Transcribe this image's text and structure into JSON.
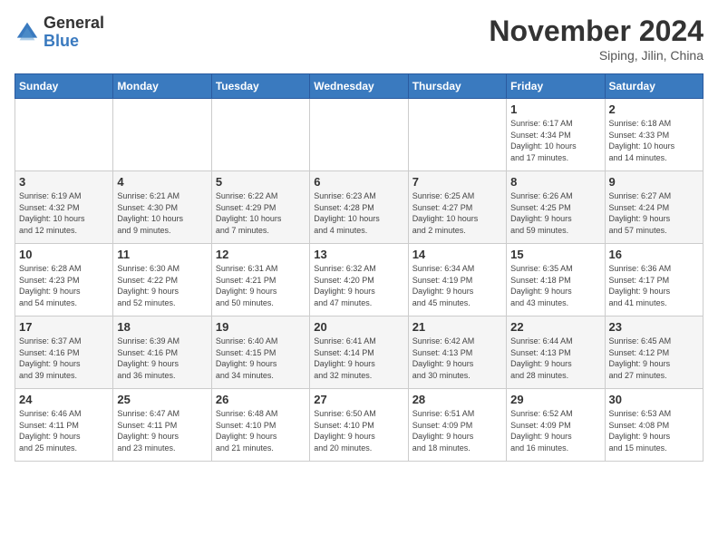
{
  "logo": {
    "general": "General",
    "blue": "Blue"
  },
  "title": "November 2024",
  "subtitle": "Siping, Jilin, China",
  "days_header": [
    "Sunday",
    "Monday",
    "Tuesday",
    "Wednesday",
    "Thursday",
    "Friday",
    "Saturday"
  ],
  "weeks": [
    [
      {
        "day": "",
        "info": ""
      },
      {
        "day": "",
        "info": ""
      },
      {
        "day": "",
        "info": ""
      },
      {
        "day": "",
        "info": ""
      },
      {
        "day": "",
        "info": ""
      },
      {
        "day": "1",
        "info": "Sunrise: 6:17 AM\nSunset: 4:34 PM\nDaylight: 10 hours\nand 17 minutes."
      },
      {
        "day": "2",
        "info": "Sunrise: 6:18 AM\nSunset: 4:33 PM\nDaylight: 10 hours\nand 14 minutes."
      }
    ],
    [
      {
        "day": "3",
        "info": "Sunrise: 6:19 AM\nSunset: 4:32 PM\nDaylight: 10 hours\nand 12 minutes."
      },
      {
        "day": "4",
        "info": "Sunrise: 6:21 AM\nSunset: 4:30 PM\nDaylight: 10 hours\nand 9 minutes."
      },
      {
        "day": "5",
        "info": "Sunrise: 6:22 AM\nSunset: 4:29 PM\nDaylight: 10 hours\nand 7 minutes."
      },
      {
        "day": "6",
        "info": "Sunrise: 6:23 AM\nSunset: 4:28 PM\nDaylight: 10 hours\nand 4 minutes."
      },
      {
        "day": "7",
        "info": "Sunrise: 6:25 AM\nSunset: 4:27 PM\nDaylight: 10 hours\nand 2 minutes."
      },
      {
        "day": "8",
        "info": "Sunrise: 6:26 AM\nSunset: 4:25 PM\nDaylight: 9 hours\nand 59 minutes."
      },
      {
        "day": "9",
        "info": "Sunrise: 6:27 AM\nSunset: 4:24 PM\nDaylight: 9 hours\nand 57 minutes."
      }
    ],
    [
      {
        "day": "10",
        "info": "Sunrise: 6:28 AM\nSunset: 4:23 PM\nDaylight: 9 hours\nand 54 minutes."
      },
      {
        "day": "11",
        "info": "Sunrise: 6:30 AM\nSunset: 4:22 PM\nDaylight: 9 hours\nand 52 minutes."
      },
      {
        "day": "12",
        "info": "Sunrise: 6:31 AM\nSunset: 4:21 PM\nDaylight: 9 hours\nand 50 minutes."
      },
      {
        "day": "13",
        "info": "Sunrise: 6:32 AM\nSunset: 4:20 PM\nDaylight: 9 hours\nand 47 minutes."
      },
      {
        "day": "14",
        "info": "Sunrise: 6:34 AM\nSunset: 4:19 PM\nDaylight: 9 hours\nand 45 minutes."
      },
      {
        "day": "15",
        "info": "Sunrise: 6:35 AM\nSunset: 4:18 PM\nDaylight: 9 hours\nand 43 minutes."
      },
      {
        "day": "16",
        "info": "Sunrise: 6:36 AM\nSunset: 4:17 PM\nDaylight: 9 hours\nand 41 minutes."
      }
    ],
    [
      {
        "day": "17",
        "info": "Sunrise: 6:37 AM\nSunset: 4:16 PM\nDaylight: 9 hours\nand 39 minutes."
      },
      {
        "day": "18",
        "info": "Sunrise: 6:39 AM\nSunset: 4:16 PM\nDaylight: 9 hours\nand 36 minutes."
      },
      {
        "day": "19",
        "info": "Sunrise: 6:40 AM\nSunset: 4:15 PM\nDaylight: 9 hours\nand 34 minutes."
      },
      {
        "day": "20",
        "info": "Sunrise: 6:41 AM\nSunset: 4:14 PM\nDaylight: 9 hours\nand 32 minutes."
      },
      {
        "day": "21",
        "info": "Sunrise: 6:42 AM\nSunset: 4:13 PM\nDaylight: 9 hours\nand 30 minutes."
      },
      {
        "day": "22",
        "info": "Sunrise: 6:44 AM\nSunset: 4:13 PM\nDaylight: 9 hours\nand 28 minutes."
      },
      {
        "day": "23",
        "info": "Sunrise: 6:45 AM\nSunset: 4:12 PM\nDaylight: 9 hours\nand 27 minutes."
      }
    ],
    [
      {
        "day": "24",
        "info": "Sunrise: 6:46 AM\nSunset: 4:11 PM\nDaylight: 9 hours\nand 25 minutes."
      },
      {
        "day": "25",
        "info": "Sunrise: 6:47 AM\nSunset: 4:11 PM\nDaylight: 9 hours\nand 23 minutes."
      },
      {
        "day": "26",
        "info": "Sunrise: 6:48 AM\nSunset: 4:10 PM\nDaylight: 9 hours\nand 21 minutes."
      },
      {
        "day": "27",
        "info": "Sunrise: 6:50 AM\nSunset: 4:10 PM\nDaylight: 9 hours\nand 20 minutes."
      },
      {
        "day": "28",
        "info": "Sunrise: 6:51 AM\nSunset: 4:09 PM\nDaylight: 9 hours\nand 18 minutes."
      },
      {
        "day": "29",
        "info": "Sunrise: 6:52 AM\nSunset: 4:09 PM\nDaylight: 9 hours\nand 16 minutes."
      },
      {
        "day": "30",
        "info": "Sunrise: 6:53 AM\nSunset: 4:08 PM\nDaylight: 9 hours\nand 15 minutes."
      }
    ]
  ]
}
